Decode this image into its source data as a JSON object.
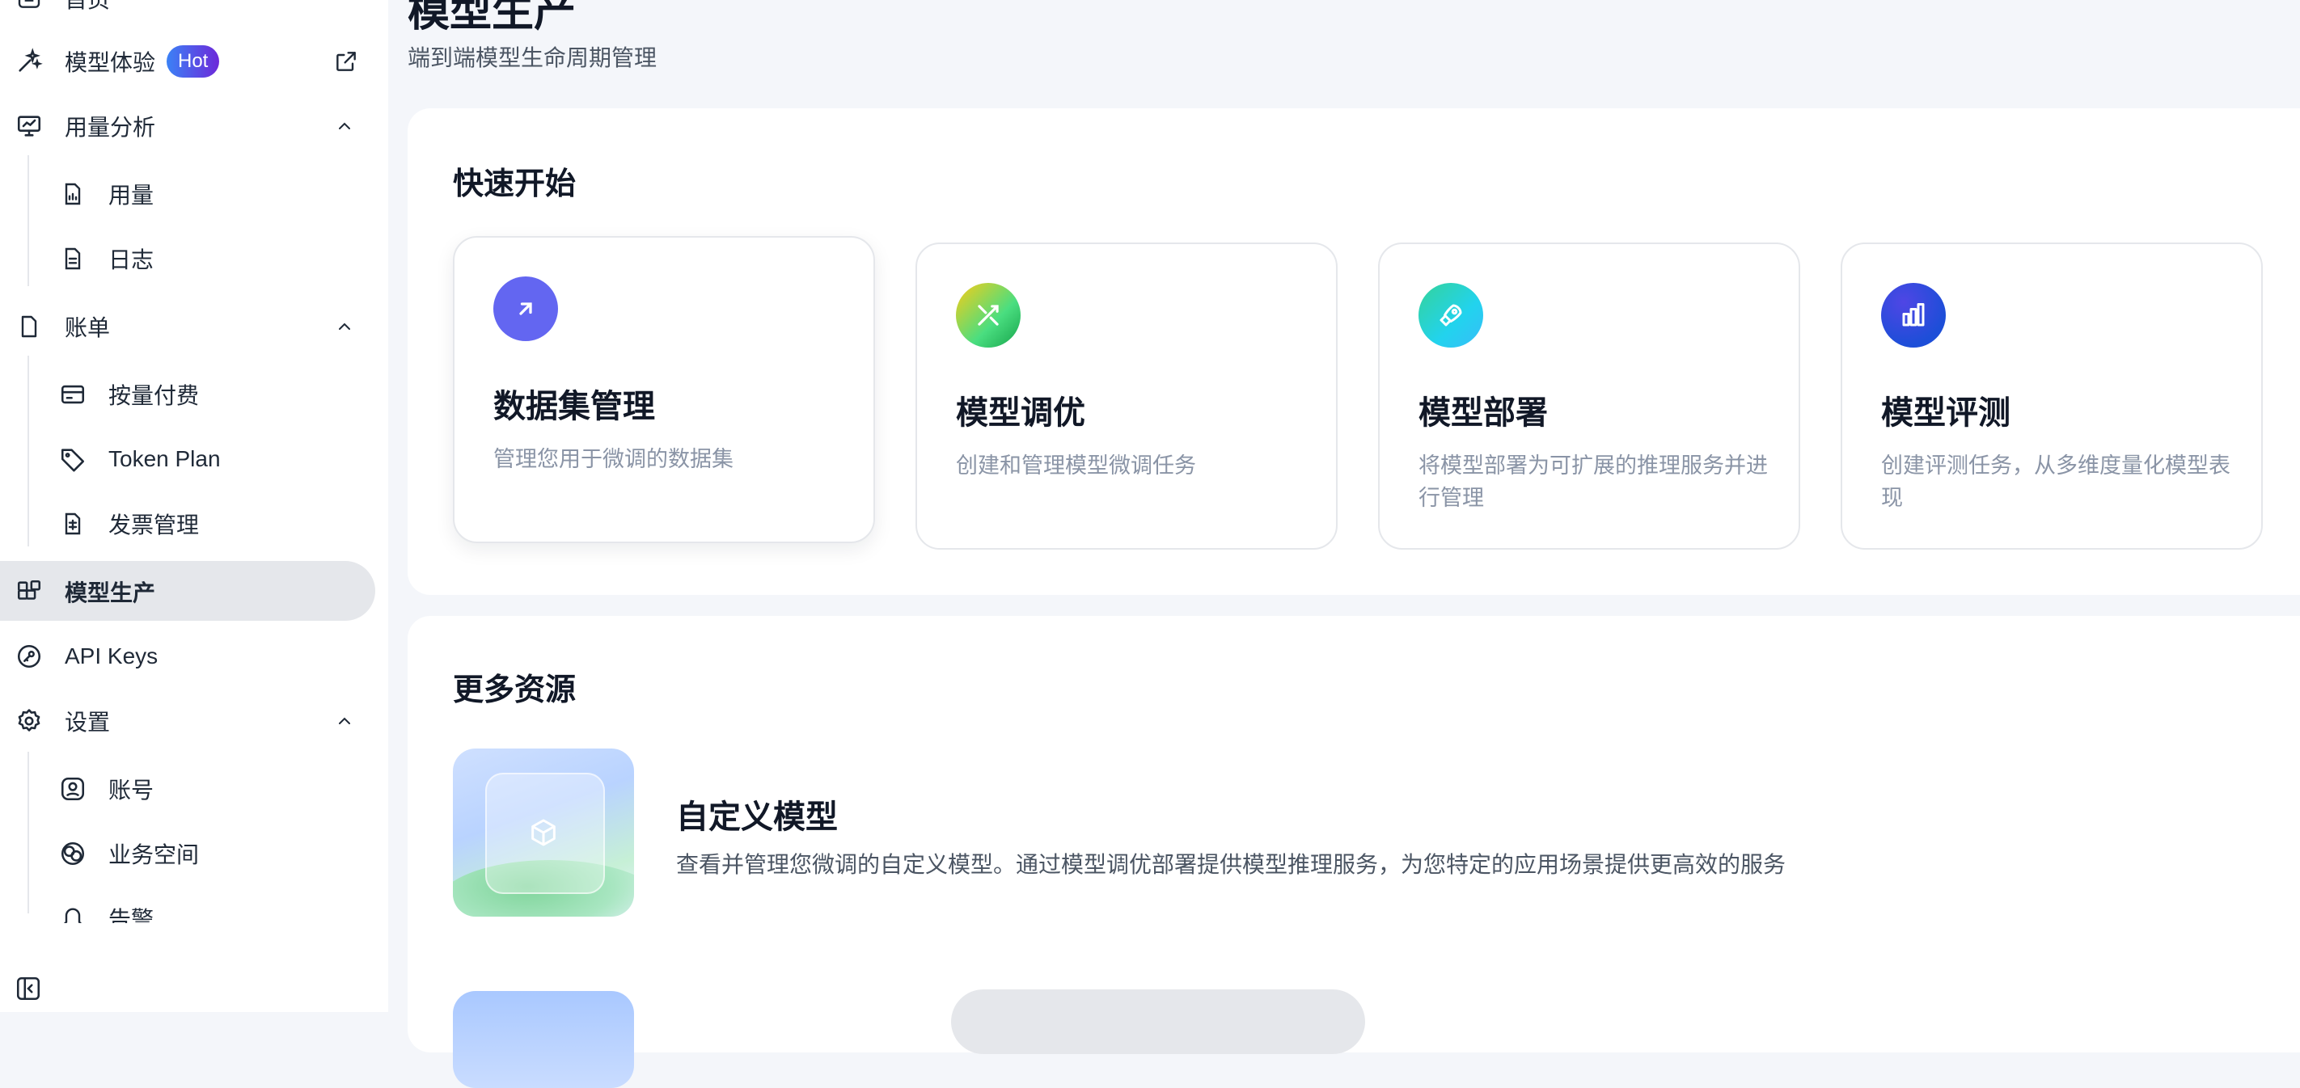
{
  "sidebar": {
    "items": [
      {
        "label": "首页"
      },
      {
        "label": "模型体验",
        "badge": "Hot"
      },
      {
        "label": "用量分析"
      },
      {
        "label": "用量"
      },
      {
        "label": "日志"
      },
      {
        "label": "账单"
      },
      {
        "label": "按量付费"
      },
      {
        "label": "Token Plan"
      },
      {
        "label": "发票管理"
      },
      {
        "label": "模型生产"
      },
      {
        "label": "API Keys"
      },
      {
        "label": "设置"
      },
      {
        "label": "账号"
      },
      {
        "label": "业务空间"
      },
      {
        "label": "告警"
      }
    ],
    "active_item": "模型生产"
  },
  "header": {
    "title": "模型生产",
    "subtitle": "端到端模型生命周期管理"
  },
  "quick_start": {
    "title": "快速开始",
    "cards": [
      {
        "title": "数据集管理",
        "desc": "管理您用于微调的数据集",
        "icon": "arrow-up-right-icon",
        "color": "#6366f1"
      },
      {
        "title": "模型调优",
        "desc": "创建和管理模型微调任务",
        "icon": "tools-icon",
        "color": "#84cc16"
      },
      {
        "title": "模型部署",
        "desc": "将模型部署为可扩展的推理服务并进行管理",
        "icon": "rocket-icon",
        "color": "#2dd4bf"
      },
      {
        "title": "模型评测",
        "desc": "创建评测任务，从多维度量化模型表现",
        "icon": "bar-chart-icon",
        "color": "#2563eb"
      }
    ]
  },
  "more_resources": {
    "title": "更多资源",
    "items": [
      {
        "title": "自定义模型",
        "desc": "查看并管理您微调的自定义模型。通过模型调优部署提供模型推理服务，为您特定的应用场景提供更高效的服务",
        "icon": "cube-icon"
      }
    ]
  }
}
